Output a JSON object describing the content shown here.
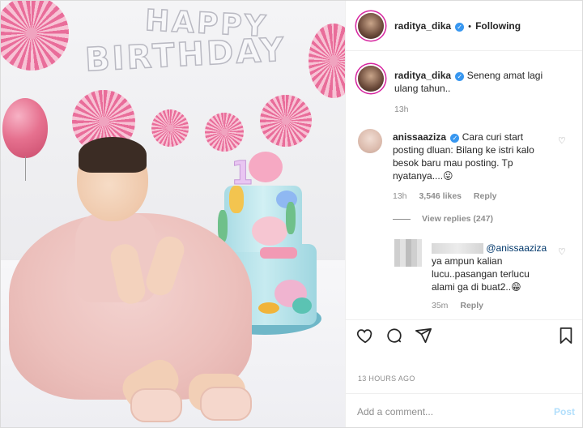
{
  "post": {
    "author": "raditya_dika",
    "following_label": "Following",
    "separator": "•",
    "verified_mark": "✓",
    "image_text": {
      "line1": "HAPPY",
      "line2": "BIRTHDAY",
      "candle": "1"
    }
  },
  "caption": {
    "user": "raditya_dika",
    "text": "Seneng amat lagi ulang tahun..",
    "time": "13h"
  },
  "comments": [
    {
      "user": "anissaaziza",
      "text": "Cara curi start posting dluan: Bilang ke istri kalo besok baru mau posting. Tp nyatanya....😛",
      "time": "13h",
      "likes": "3,546 likes",
      "reply_label": "Reply"
    }
  ],
  "view_replies": "View replies (247)",
  "reply": {
    "mention": "@anissaaziza",
    "text": "ya ampun kalian lucu..pasangan terlucu alami ga di buat2..😁",
    "time": "35m",
    "reply_label": "Reply"
  },
  "actions": {
    "like_icon": "heart-icon",
    "comment_icon": "comment-icon",
    "share_icon": "share-icon",
    "save_icon": "bookmark-icon"
  },
  "timestamp": "13 HOURS AGO",
  "add_comment": {
    "placeholder": "Add a comment...",
    "post_label": "Post"
  },
  "colors": {
    "verified": "#3897f0",
    "link": "#00376b",
    "muted": "#8e8e8e",
    "post_disabled": "#b2dffc"
  }
}
